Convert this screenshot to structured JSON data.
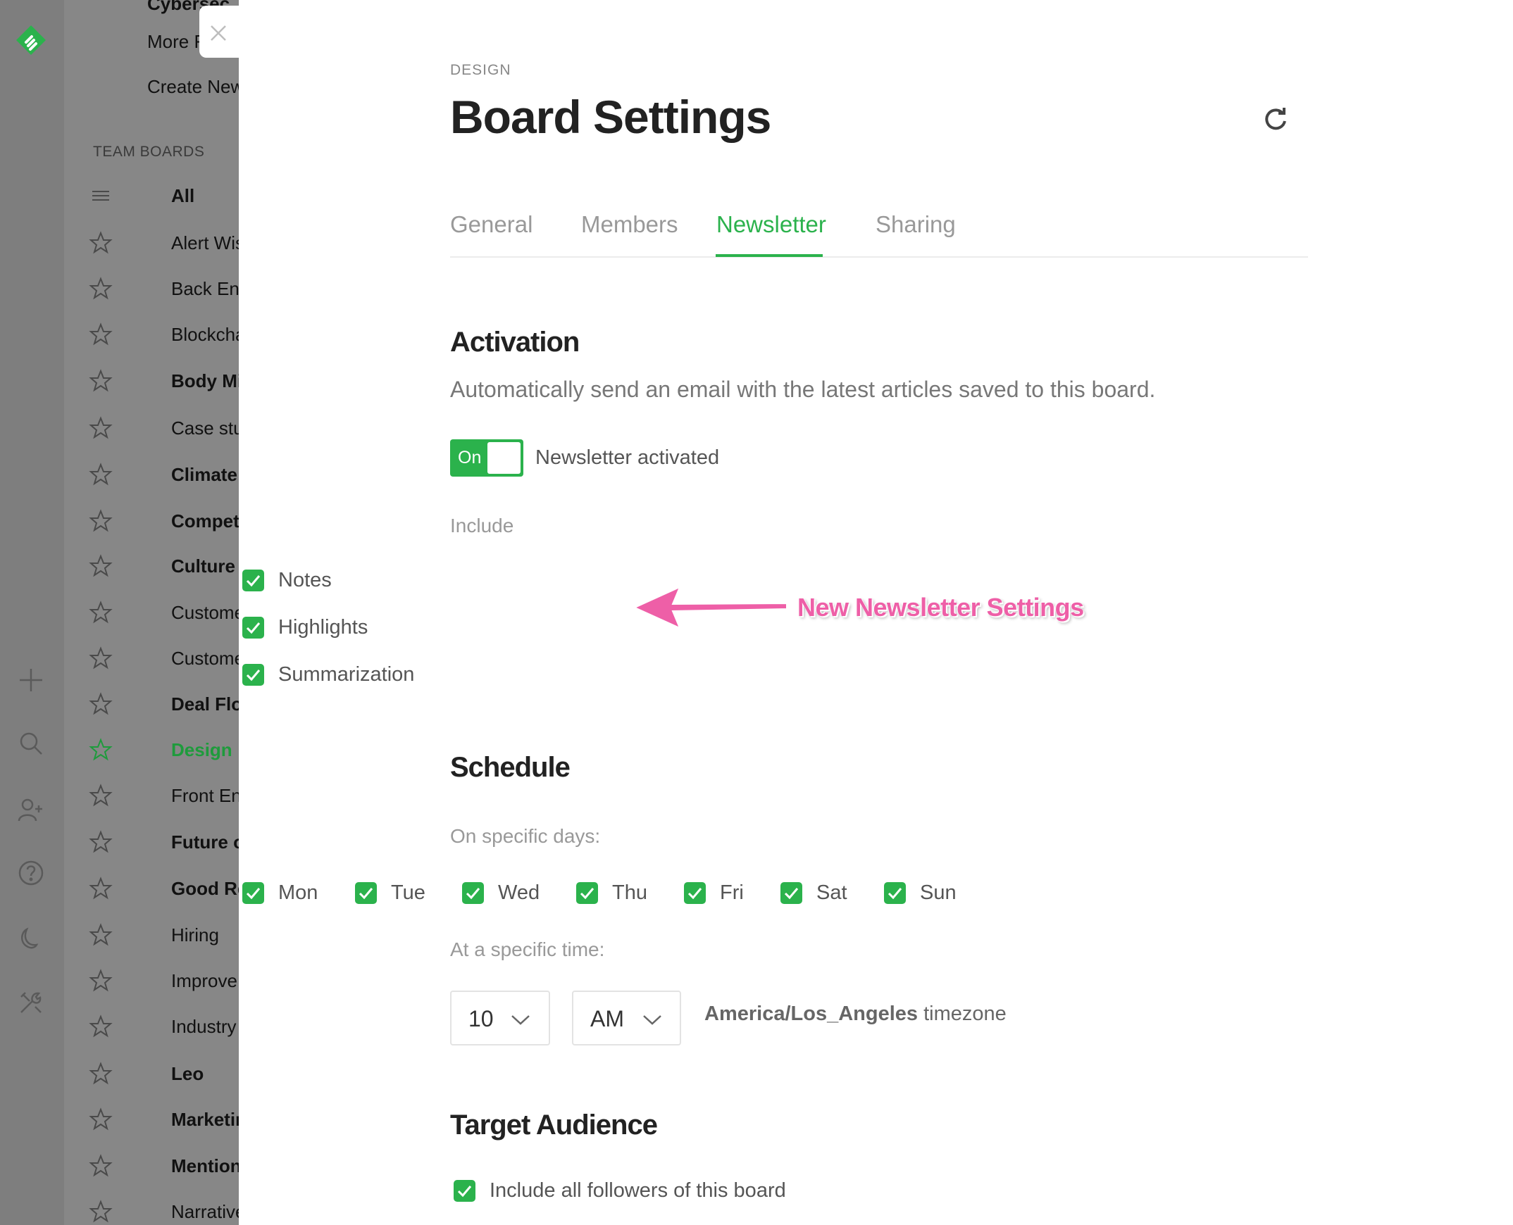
{
  "sidebar": {
    "partial_top": "Cybersec",
    "more": "More F",
    "create_new": "Create New",
    "section_title": "TEAM BOARDS",
    "items": [
      {
        "label": "All"
      },
      {
        "label": "Alert Wishli"
      },
      {
        "label": "Back End D"
      },
      {
        "label": "Blockchain"
      },
      {
        "label": "Body Mind"
      },
      {
        "label": "Case study"
      },
      {
        "label": "Climate Ch"
      },
      {
        "label": "Competitio"
      },
      {
        "label": "Culture"
      },
      {
        "label": "Customer S"
      },
      {
        "label": "Customer V"
      },
      {
        "label": "Deal Flow"
      },
      {
        "label": "Design"
      },
      {
        "label": "Front End"
      },
      {
        "label": "Future of N"
      },
      {
        "label": "Good Read"
      },
      {
        "label": "Hiring"
      },
      {
        "label": "Improve Le"
      },
      {
        "label": "Industry Tre"
      },
      {
        "label": "Leo"
      },
      {
        "label": "Marketing"
      },
      {
        "label": "Mentions"
      },
      {
        "label": "Narrative"
      }
    ]
  },
  "panel": {
    "eyebrow": "DESIGN",
    "title": "Board Settings",
    "tabs": [
      "General",
      "Members",
      "Newsletter",
      "Sharing"
    ],
    "active_tab": "Newsletter",
    "activation": {
      "heading": "Activation",
      "description": "Automatically send an email with the latest articles saved to this board.",
      "toggle_label": "On",
      "toggle_state": "on",
      "status_text": "Newsletter activated"
    },
    "include": {
      "label": "Include",
      "options": [
        {
          "label": "Notes",
          "checked": true
        },
        {
          "label": "Highlights",
          "checked": true
        },
        {
          "label": "Summarization",
          "checked": true
        }
      ]
    },
    "annotation": {
      "text": "New Newsletter Settings",
      "color": "#ee5fa7"
    },
    "schedule": {
      "heading": "Schedule",
      "days_label": "On specific days:",
      "days": [
        {
          "label": "Mon",
          "checked": true
        },
        {
          "label": "Tue",
          "checked": true
        },
        {
          "label": "Wed",
          "checked": true
        },
        {
          "label": "Thu",
          "checked": true
        },
        {
          "label": "Fri",
          "checked": true
        },
        {
          "label": "Sat",
          "checked": true
        },
        {
          "label": "Sun",
          "checked": true
        }
      ],
      "time_label": "At a specific time:",
      "hour": "10",
      "meridiem": "AM",
      "timezone_name": "America/Los_Angeles",
      "timezone_suffix": "timezone"
    },
    "audience": {
      "heading": "Target Audience",
      "option": "Include all followers of this board",
      "checked": true
    }
  },
  "colors": {
    "accent": "#2bb24c",
    "annotation": "#ee5fa7"
  }
}
